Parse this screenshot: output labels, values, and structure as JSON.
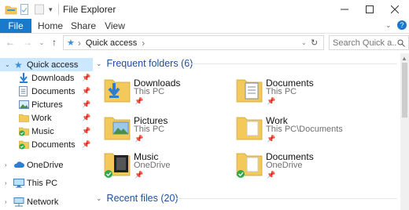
{
  "window": {
    "title": "File Explorer"
  },
  "ribbon": {
    "tabs": [
      "File",
      "Home",
      "Share",
      "View"
    ]
  },
  "address": {
    "crumb": "Quick access",
    "separator": "›"
  },
  "search": {
    "placeholder": "Search Quick a..."
  },
  "nav": {
    "items": [
      {
        "label": "Quick access",
        "icon": "star-icon",
        "pinned": false,
        "selected": true
      },
      {
        "label": "Downloads",
        "icon": "download-folder-icon",
        "pinned": true
      },
      {
        "label": "Documents",
        "icon": "documents-folder-icon",
        "pinned": true
      },
      {
        "label": "Pictures",
        "icon": "pictures-folder-icon",
        "pinned": true
      },
      {
        "label": "Work",
        "icon": "folder-icon",
        "pinned": true
      },
      {
        "label": "Music",
        "icon": "folder-synced-icon",
        "pinned": true
      },
      {
        "label": "Documents",
        "icon": "folder-synced-icon",
        "pinned": true
      },
      {
        "label": "OneDrive",
        "icon": "cloud-icon",
        "pinned": false
      },
      {
        "label": "This PC",
        "icon": "computer-icon",
        "pinned": false
      },
      {
        "label": "Network",
        "icon": "network-icon",
        "pinned": false
      }
    ]
  },
  "content": {
    "frequent_header": "Frequent folders (6)",
    "recent_header": "Recent files (20)",
    "folders": [
      {
        "name": "Downloads",
        "location": "This PC"
      },
      {
        "name": "Documents",
        "location": "This PC"
      },
      {
        "name": "Pictures",
        "location": "This PC"
      },
      {
        "name": "Work",
        "location": "This PC\\Documents"
      },
      {
        "name": "Music",
        "location": "OneDrive"
      },
      {
        "name": "Documents",
        "location": "OneDrive"
      }
    ]
  },
  "colors": {
    "accent": "#1979ca",
    "selection": "#cce8ff",
    "folder": "#f3c959",
    "group_header": "#1e4e9a"
  }
}
